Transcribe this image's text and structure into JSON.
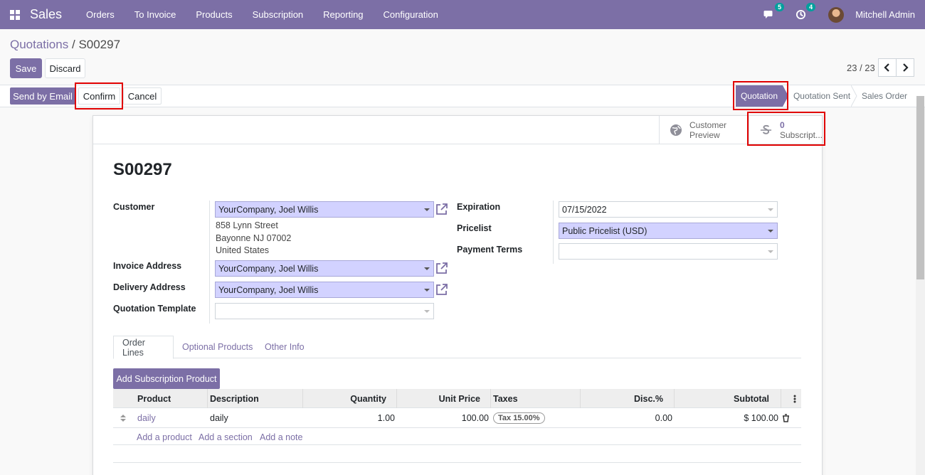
{
  "navbar": {
    "app_name": "Sales",
    "menu": [
      "Orders",
      "To Invoice",
      "Products",
      "Subscription",
      "Reporting",
      "Configuration"
    ],
    "messages_count": "5",
    "activities_count": "4",
    "user_name": "Mitchell Admin"
  },
  "breadcrumb": {
    "parent": "Quotations",
    "separator": "/",
    "current": "S00297"
  },
  "actions": {
    "save": "Save",
    "discard": "Discard"
  },
  "pager": {
    "text": "23 / 23"
  },
  "statusbar": {
    "buttons": {
      "send_email": "Send by Email",
      "confirm": "Confirm",
      "cancel": "Cancel"
    },
    "stages": [
      "Quotation",
      "Quotation Sent",
      "Sales Order"
    ],
    "active_stage": "Quotation"
  },
  "smart_buttons": {
    "customer_preview_line1": "Customer",
    "customer_preview_line2": "Preview",
    "subscriptions_count": "0",
    "subscriptions_label": "Subscript..."
  },
  "record": {
    "name": "S00297",
    "labels": {
      "customer": "Customer",
      "invoice_address": "Invoice Address",
      "delivery_address": "Delivery Address",
      "quotation_template": "Quotation Template",
      "expiration": "Expiration",
      "pricelist": "Pricelist",
      "payment_terms": "Payment Terms"
    },
    "customer": "YourCompany, Joel Willis",
    "address_lines": [
      "858 Lynn Street",
      "Bayonne NJ 07002",
      "United States"
    ],
    "invoice_address": "YourCompany, Joel Willis",
    "delivery_address": "YourCompany, Joel Willis",
    "quotation_template": "",
    "expiration": "07/15/2022",
    "pricelist": "Public Pricelist (USD)",
    "payment_terms": ""
  },
  "tabs": [
    "Order Lines",
    "Optional Products",
    "Other Info"
  ],
  "order_lines": {
    "add_subscription_button": "Add Subscription Product",
    "columns": [
      "Product",
      "Description",
      "Quantity",
      "Unit Price",
      "Taxes",
      "Disc.%",
      "Subtotal"
    ],
    "rows": [
      {
        "product": "daily",
        "description": "daily",
        "quantity": "1.00",
        "unit_price": "100.00",
        "taxes": "Tax 15.00%",
        "discount": "0.00",
        "subtotal": "$ 100.00"
      }
    ],
    "add_links": [
      "Add a product",
      "Add a section",
      "Add a note"
    ]
  },
  "colors": {
    "brand": "#7c6fa6",
    "highlight": "#e00000",
    "required_field": "#d2d2ff"
  }
}
